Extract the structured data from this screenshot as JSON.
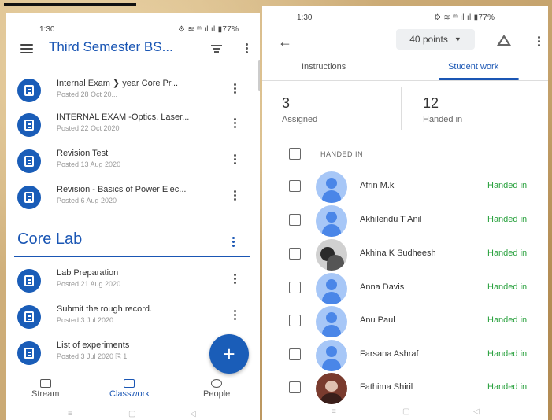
{
  "left": {
    "status_time": "1:30",
    "status_right": "⚙ ≋ ᵐ ıl ıl ▮77%",
    "title": "Third Semester BS...",
    "items": [
      {
        "title": "Internal Exam  ❯ year Core Pr...",
        "date": "Posted 28 Oct 20..."
      },
      {
        "title": "INTERNAL EXAM -Optics, Laser...",
        "date": "Posted 22 Oct 2020"
      },
      {
        "title": "Revision Test",
        "date": "Posted 13 Aug 2020"
      },
      {
        "title": "Revision - Basics of Power Elec...",
        "date": "Posted 6 Aug 2020"
      }
    ],
    "section": "Core Lab",
    "lab_items": [
      {
        "title": "Lab Preparation",
        "date": "Posted 21 Aug 2020"
      },
      {
        "title": "Submit the rough record.",
        "date": "Posted 3 Jul 2020"
      },
      {
        "title": "List of experiments",
        "date": "Posted 3 Jul 2020  ⎘ 1"
      }
    ],
    "fab_label": "+",
    "nav": [
      {
        "label": "Stream"
      },
      {
        "label": "Classwork"
      },
      {
        "label": "People"
      }
    ]
  },
  "right": {
    "status_time": "1:30",
    "status_right": "⚙ ≋ ᵐ ıl ıl ▮77%",
    "points": "40 points",
    "tabs": [
      {
        "label": "Instructions"
      },
      {
        "label": "Student work"
      }
    ],
    "assigned_count": "3",
    "assigned_label": "Assigned",
    "handed_count": "12",
    "handed_label": "Handed in",
    "handed_header": "HANDED IN",
    "students": [
      {
        "name": "Afrin M.k",
        "status": "Handed in"
      },
      {
        "name": "Akhilendu T Anil",
        "status": "Handed in"
      },
      {
        "name": "Akhina K Sudheesh",
        "status": "Handed in"
      },
      {
        "name": "Anna Davis",
        "status": "Handed in"
      },
      {
        "name": "Anu Paul",
        "status": "Handed in"
      },
      {
        "name": "Farsana Ashraf",
        "status": "Handed in"
      },
      {
        "name": "Fathima Shiril",
        "status": "Handed in"
      }
    ]
  },
  "colors": {
    "accent": "#1a56b4",
    "status_green": "#27a03c"
  }
}
